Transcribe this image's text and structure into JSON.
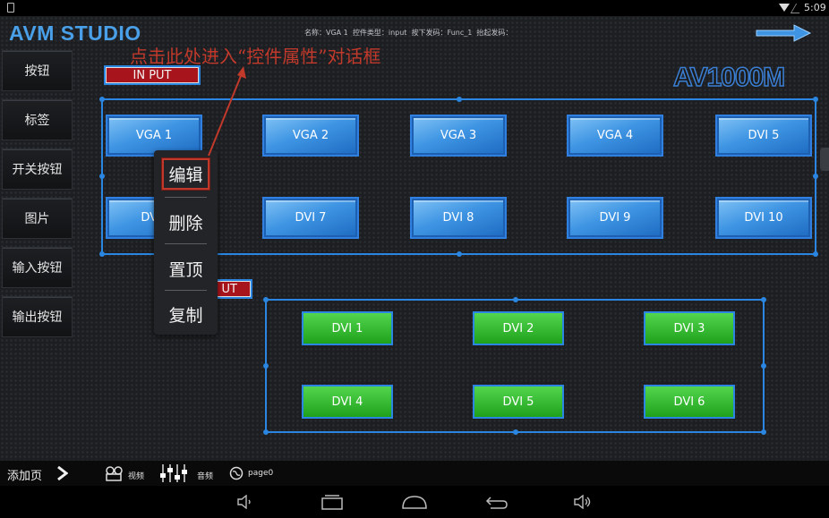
{
  "status_bar": {
    "time": "5:09"
  },
  "header": {
    "logo": "AVM STUDIO",
    "info": "名称：VGA 1  控件类型：input  按下发码：Func_1  抬起发码："
  },
  "annotation": "点击此处进入“控件属性”对话框",
  "sidebar": {
    "items": [
      {
        "label": "按钮"
      },
      {
        "label": "标签"
      },
      {
        "label": "开关按钮"
      },
      {
        "label": "图片"
      },
      {
        "label": "输入按钮"
      },
      {
        "label": "输出按钮"
      }
    ]
  },
  "canvas": {
    "input_label": "IN PUT",
    "output_label": "OUTPUT",
    "output_label_visible": "UT",
    "device_label": "AV1000M",
    "input_buttons": [
      "VGA 1",
      "VGA 2",
      "VGA 3",
      "VGA 4",
      "DVI 5",
      "DV",
      "DVI 7",
      "DVI 8",
      "DVI 9",
      "DVI 10"
    ],
    "output_buttons": [
      "DVI 1",
      "DVI 2",
      "DVI 3",
      "DVI 4",
      "DVI 5",
      "DVI 6"
    ]
  },
  "context_menu": {
    "items": [
      {
        "label": "编辑",
        "highlighted": true
      },
      {
        "label": "删除"
      },
      {
        "label": "置顶"
      },
      {
        "label": "复制"
      }
    ]
  },
  "bottom_bar": {
    "add_page": "添加页",
    "video": "视频",
    "audio": "音频",
    "page": "page0"
  },
  "colors": {
    "accent_blue": "#2a86e0",
    "annotation_red": "#c0392b",
    "input_chip_red": "#a8141b",
    "output_green": "#2fb82a"
  }
}
